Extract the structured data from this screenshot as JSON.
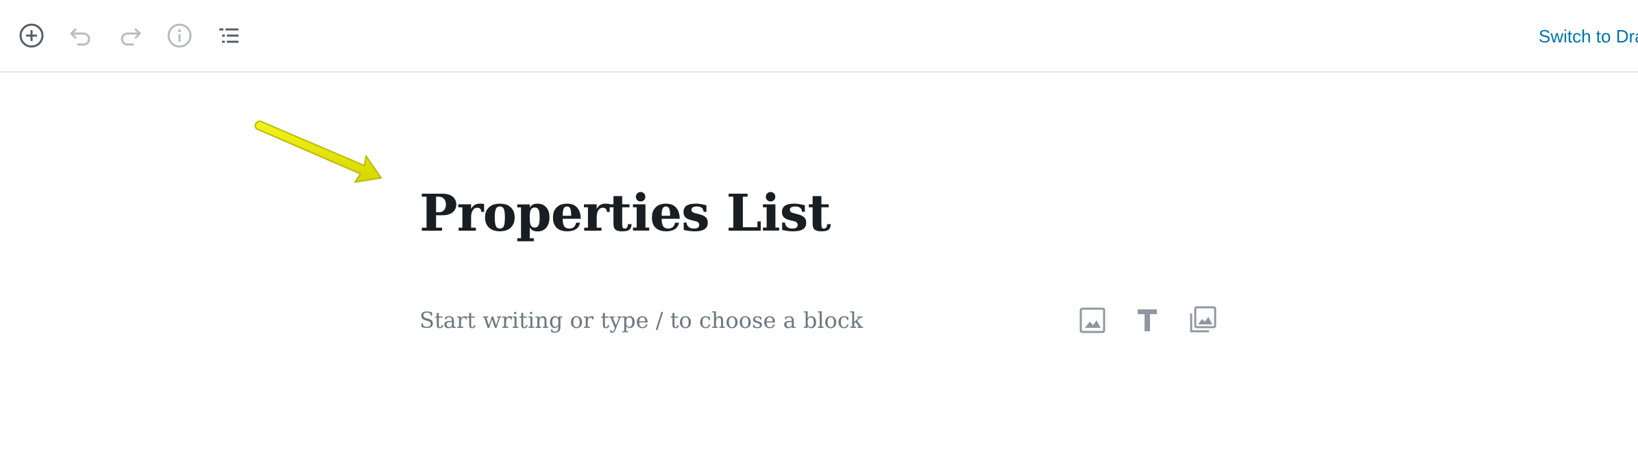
{
  "toolbar": {
    "buttons": [
      {
        "name": "add-block",
        "icon": "plus-circle-icon"
      },
      {
        "name": "undo",
        "icon": "undo-icon"
      },
      {
        "name": "redo",
        "icon": "redo-icon"
      },
      {
        "name": "content-info",
        "icon": "info-icon"
      },
      {
        "name": "block-navigation",
        "icon": "list-icon"
      }
    ],
    "switch_to_draft_label": "Switch to Draft"
  },
  "editor": {
    "post_title": "Properties List",
    "appender_placeholder": "Start writing or type / to choose a block",
    "quick_inserters": [
      {
        "name": "image-block",
        "icon": "image-icon"
      },
      {
        "name": "heading-block",
        "icon": "heading-t-icon"
      },
      {
        "name": "gallery-block",
        "icon": "gallery-icon"
      }
    ]
  },
  "annotation": {
    "arrow_color": "#e8e80c",
    "icon": "yellow-arrow-icon"
  },
  "colors": {
    "accent": "#0073aa",
    "title_text": "#191e23",
    "placeholder_text": "#6c7781",
    "icon_active": "#555d66",
    "icon_disabled": "#b5bcc2"
  }
}
